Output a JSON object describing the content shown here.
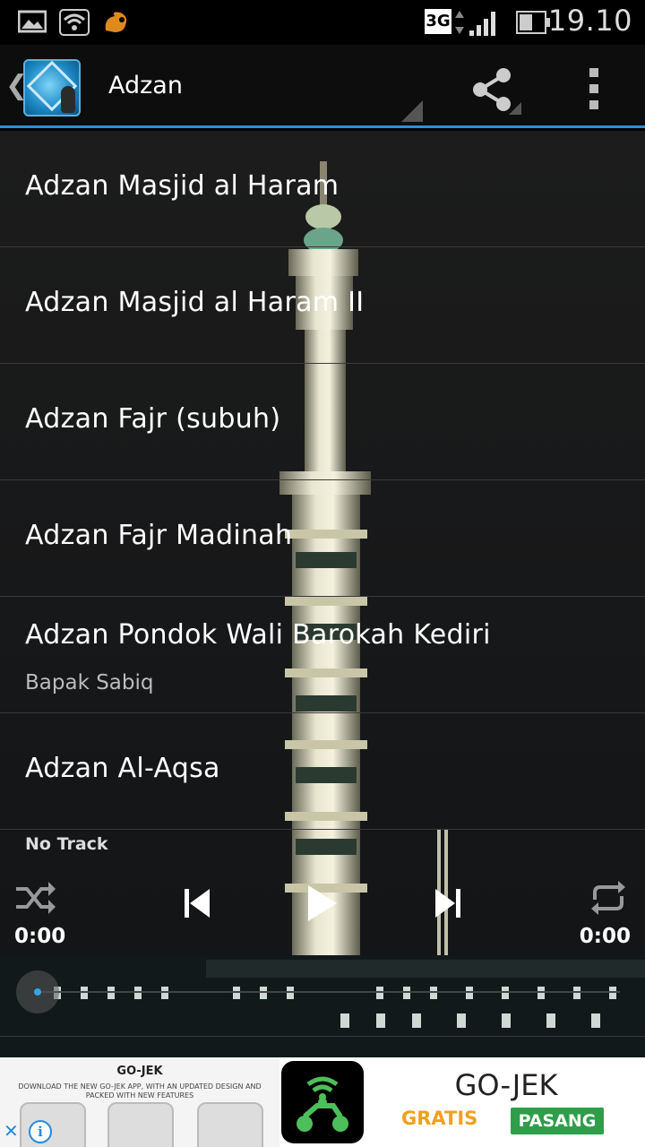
{
  "status_bar": {
    "time": "19.10",
    "network": "3G",
    "icons": [
      "gallery-icon",
      "wifi-icon",
      "uc-browser-icon",
      "signal-icon",
      "battery-icon"
    ]
  },
  "action_bar": {
    "title": "Adzan",
    "accent_color": "#2e8fd2"
  },
  "tracks": [
    {
      "title": "Adzan Masjid al Haram",
      "subtitle": ""
    },
    {
      "title": "Adzan Masjid al Haram II",
      "subtitle": ""
    },
    {
      "title": "Adzan Fajr (subuh)",
      "subtitle": ""
    },
    {
      "title": "Adzan Fajr Madinah",
      "subtitle": ""
    },
    {
      "title": "Adzan Pondok Wali Barokah Kediri",
      "subtitle": "Bapak Sabiq"
    },
    {
      "title": "Adzan Al-Aqsa",
      "subtitle": ""
    }
  ],
  "player": {
    "now_playing": "No Track",
    "elapsed": "0:00",
    "duration": "0:00",
    "progress": 0,
    "seek_color": "#2fa6e8"
  },
  "ad": {
    "brand_small": "GO-JEK",
    "tagline": "DOWNLOAD THE NEW GO-JEK APP, WITH AN UPDATED DESIGN AND PACKED WITH NEW FEATURES",
    "title": "GO-JEK",
    "price": "GRATIS",
    "install_label": "PASANG",
    "info_glyph": "i",
    "close_glyph": "✕",
    "brand_color": "#2e9e48"
  }
}
